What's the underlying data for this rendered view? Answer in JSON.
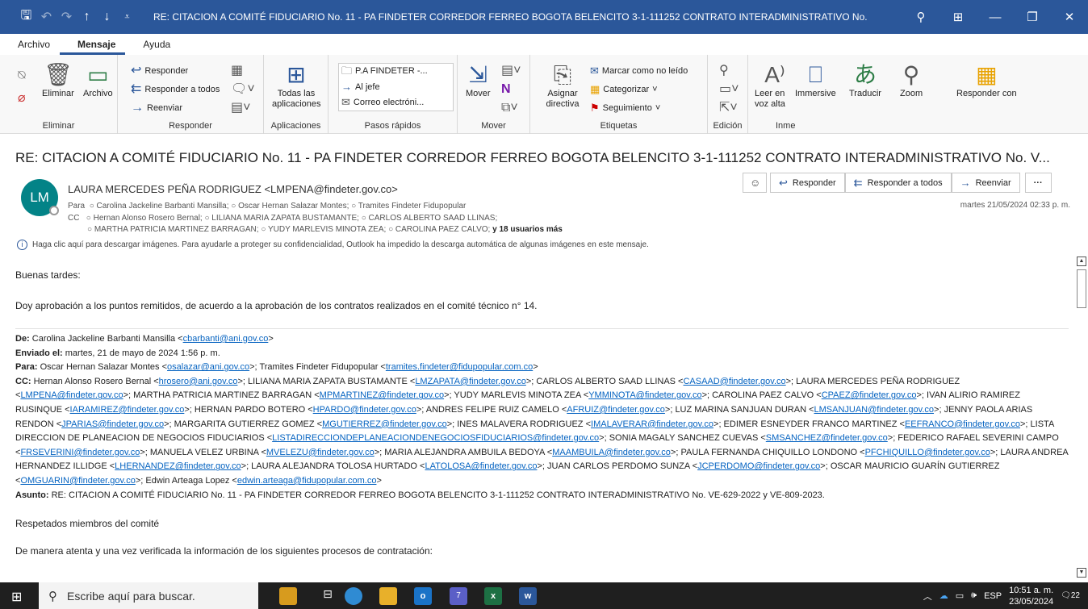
{
  "window": {
    "title": "RE: CITACION A COMITÉ FIDUCIARIO No. 11 -  PA FINDETER CORREDOR FERREO BOGOTA BELENCITO 3-1-111252 CONTRATO INTERADMINISTRATIVO No. VE-629-2022 y V...",
    "search_icon": "search-icon",
    "quick_access": [
      "save-icon",
      "undo-icon",
      "redo-icon",
      "up-arrow-icon",
      "down-arrow-icon",
      "customize-icon"
    ]
  },
  "menu": {
    "items": [
      "Archivo",
      "Mensaje",
      "Ayuda"
    ],
    "active": "Mensaje"
  },
  "ribbon": {
    "eliminar": {
      "delete": "Eliminar",
      "archive": "Archivo",
      "label": "Eliminar"
    },
    "responder": {
      "reply": "Responder",
      "reply_all": "Responder a todos",
      "forward": "Reenviar",
      "label": "Responder"
    },
    "aplicaciones": {
      "all_apps": "Todas las aplicaciones",
      "label": "Aplicaciones"
    },
    "pasos": {
      "s1": "P.A FINDETER -...",
      "s2": "Al jefe",
      "s3": "Correo electróni...",
      "label": "Pasos rápidos"
    },
    "mover": {
      "move": "Mover",
      "label": "Mover"
    },
    "etiquetas": {
      "assign": "Asignar directiva",
      "mark_unread": "Marcar como no leído",
      "categorize": "Categorizar",
      "followup": "Seguimiento",
      "label": "Etiquetas"
    },
    "edicion": {
      "label": "Edición"
    },
    "inmersivo": {
      "read_aloud": "Leer en voz alta",
      "immersive": "Immersive",
      "translate": "Traducir",
      "zoom": "Zoom",
      "reply_with": "Responder con",
      "label": "Inme"
    }
  },
  "message": {
    "subject": "RE: CITACION A COMITÉ FIDUCIARIO No. 11 -  PA FINDETER CORREDOR FERREO BOGOTA BELENCITO 3-1-111252 CONTRATO INTERADMINISTRATIVO No. V...",
    "avatar": "LM",
    "sender": "LAURA MERCEDES PEÑA RODRIGUEZ <LMPENA@findeter.gov.co>",
    "to_label": "Para",
    "to": "○ Carolina Jackeline Barbanti Mansilla; ○ Oscar Hernan Salazar Montes; ○ Tramites Findeter Fidupopular",
    "cc_label": "CC",
    "cc1": "○ Hernan Alonso Rosero Bernal; ○ LILIANA MARIA ZAPATA BUSTAMANTE; ○ CARLOS ALBERTO SAAD LLINAS;",
    "cc2": "○ MARTHA PATRICIA MARTINEZ BARRAGAN; ○ YUDY MARLEVIS MINOTA ZEA; ○ CAROLINA PAEZ CALVO;",
    "cc_more": "y 18 usuarios más",
    "date": "martes 21/05/2024 02:33 p. m.",
    "info": "Haga clic aquí para descargar imágenes. Para ayudarle a proteger su confidencialidad, Outlook ha impedido la descarga automática de algunas imágenes en este mensaje.",
    "actions": {
      "reply": "Responder",
      "reply_all": "Responder a todos",
      "forward": "Reenviar",
      "more": "···"
    },
    "greeting": "Buenas tardes:",
    "approval": "Doy aprobación a los puntos remitidos, de acuerdo a la aprobación de los contratos realizados en el comité técnico n° 14.",
    "quoted": {
      "de_label": "De:",
      "de": "Carolina Jackeline Barbanti Mansilla <",
      "de_mail": "cbarbanti@ani.gov.co",
      "de_end": ">",
      "enviado_label": "Enviado el:",
      "enviado": "martes, 21 de mayo de 2024 1:56 p. m.",
      "para_label": "Para:",
      "asunto_label": "Asunto:",
      "asunto": "RE: CITACION A COMITÉ FIDUCIARIO No. 11 - PA FINDETER CORREDOR FERREO BOGOTA BELENCITO 3-1-111252 CONTRATO INTERADMINISTRATIVO No. VE-629-2022 y VE-809-2023.",
      "cc_label": "CC:"
    },
    "respetados": "Respetados miembros del comité",
    "last_line": "De manera atenta y una vez verificada la información de los siguientes procesos de contratación:"
  },
  "taskbar": {
    "search": "Escribe aquí para buscar.",
    "lang": "ESP",
    "time": "10:51 a. m.",
    "date": "23/05/2024",
    "notif": "22",
    "teams_badge": "7"
  }
}
